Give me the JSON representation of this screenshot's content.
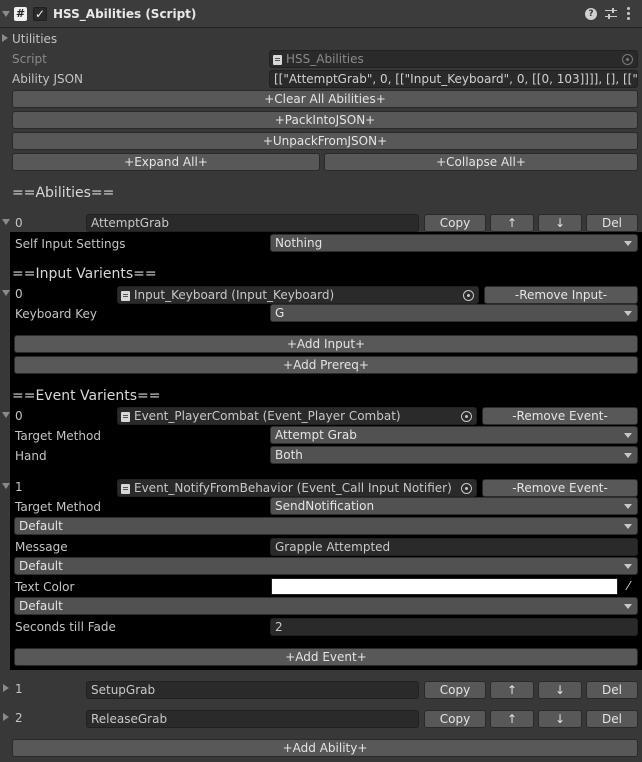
{
  "header": {
    "title": "HSS_Abilities (Script)",
    "script_icon": "script-hash-icon",
    "enabled_checkbox": true,
    "help_icon": "help-icon",
    "settings_icon": "sliders-icon",
    "menu_icon": "kebab-menu-icon"
  },
  "utilities_label": "Utilities",
  "script_label": "Script",
  "script_value": "HSS_Abilities",
  "ability_json_label": "Ability JSON",
  "ability_json_value": "[[\"AttemptGrab\", 0, [[\"Input_Keyboard\", 0, [[0, 103]]]], [], [[\"Event_PlayerCombat\"",
  "buttons": {
    "clear_all": "+Clear All Abilities+",
    "pack": "+PackIntoJSON+",
    "unpack": "+UnpackFromJSON+",
    "expand_all": "+Expand All+",
    "collapse_all": "+Collapse All+",
    "add_ability": "+Add Ability+"
  },
  "abilities_heading": "==Abilities==",
  "row_buttons": {
    "copy": "Copy",
    "up": "↑",
    "down": "↓",
    "del": "Del"
  },
  "abilities": [
    {
      "index": "0",
      "name": "AttemptGrab",
      "self_input_label": "Self Input Settings",
      "self_input_value": "Nothing",
      "input_heading": "==Input Varients==",
      "input": {
        "index": "0",
        "object": "Input_Keyboard (Input_Keyboard)",
        "remove_label": "-Remove Input-",
        "key_label": "Keyboard Key",
        "key_value": "G"
      },
      "add_input": "+Add Input+",
      "add_prereq": "+Add Prereq+",
      "event_heading": "==Event Varients==",
      "events": [
        {
          "index": "0",
          "object": "Event_PlayerCombat (Event_Player Combat)",
          "remove_label": "-Remove Event-",
          "target_label": "Target Method",
          "target_value": "Attempt Grab",
          "hand_label": "Hand",
          "hand_value": "Both"
        },
        {
          "index": "1",
          "object": "Event_NotifyFromBehavior (Event_Call Input Notifier)",
          "remove_label": "-Remove Event-",
          "target_label": "Target Method",
          "target_value": "SendNotification",
          "default1": "Default",
          "message_label": "Message",
          "message_value": "Grapple Attempted",
          "default2": "Default",
          "text_color_label": "Text Color",
          "text_color_value": "#ffffff",
          "default3": "Default",
          "fade_label": "Seconds till Fade",
          "fade_value": "2"
        }
      ],
      "add_event": "+Add Event+"
    },
    {
      "index": "1",
      "name": "SetupGrab"
    },
    {
      "index": "2",
      "name": "ReleaseGrab"
    }
  ]
}
